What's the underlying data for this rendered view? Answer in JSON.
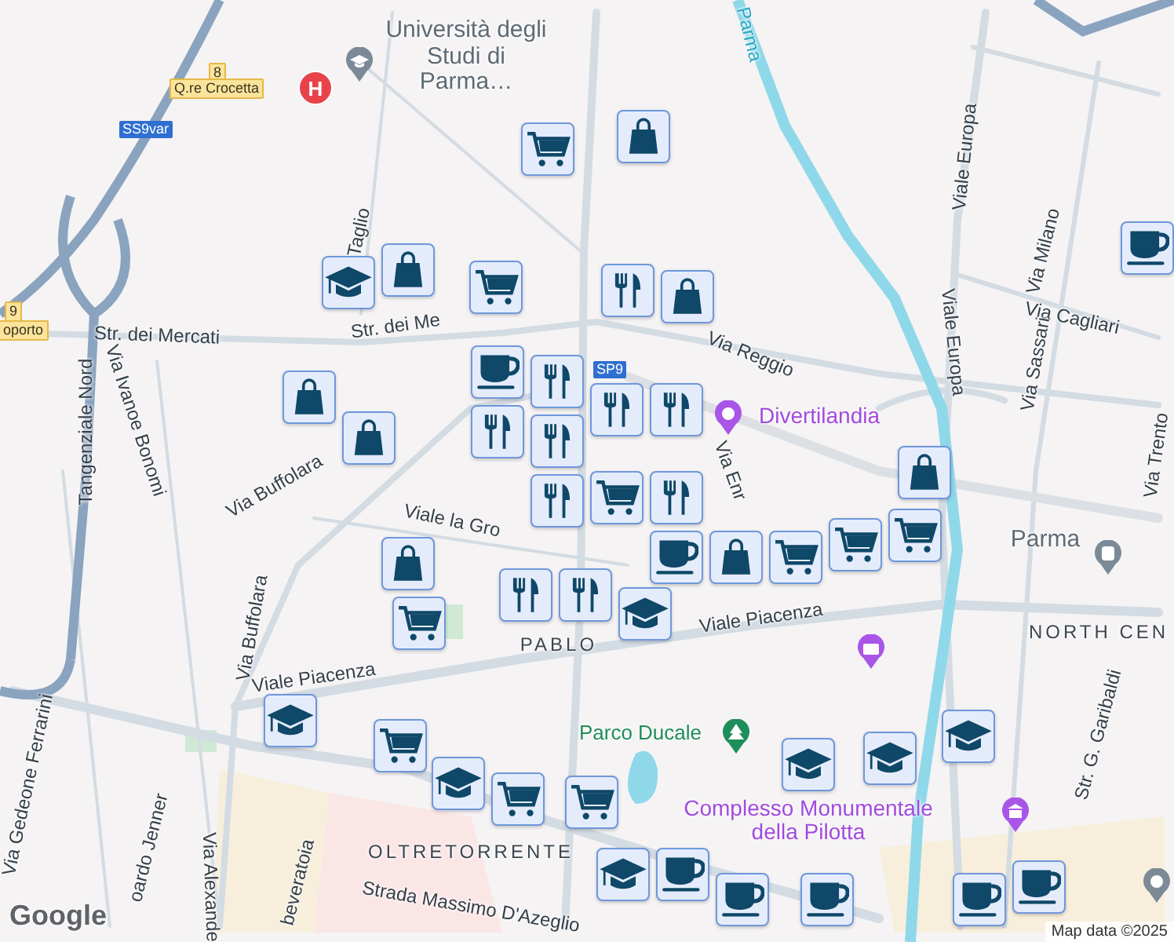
{
  "map": {
    "labels": [
      {
        "text": "Università degli Studi di Parma…",
        "kind": "poi"
      },
      {
        "text": "Taglio",
        "kind": "street"
      },
      {
        "text": "Str. dei Mercati",
        "kind": "street"
      },
      {
        "text": "Str. dei Me",
        "kind": "street"
      },
      {
        "text": "Tangenziale Nord",
        "kind": "street"
      },
      {
        "text": "Via Ivanoe Bonomi",
        "kind": "street"
      },
      {
        "text": "Via Reggio",
        "kind": "street"
      },
      {
        "text": "Divertilandia",
        "kind": "attraction"
      },
      {
        "text": "Parma",
        "kind": "water"
      },
      {
        "text": "Viale Europa",
        "kind": "street"
      },
      {
        "text": "Viale Europa",
        "kind": "street"
      },
      {
        "text": "Via Milano",
        "kind": "street"
      },
      {
        "text": "Via Cagliari",
        "kind": "street"
      },
      {
        "text": "Via Sassari",
        "kind": "street"
      },
      {
        "text": "Via Buffolara",
        "kind": "street"
      },
      {
        "text": "Via Buffolara",
        "kind": "street"
      },
      {
        "text": "Viale la Gro",
        "kind": "street"
      },
      {
        "text": "PABLO",
        "kind": "district"
      },
      {
        "text": "Viale Piacenza",
        "kind": "street"
      },
      {
        "text": "Viale Piacenza",
        "kind": "street"
      },
      {
        "text": "Parma",
        "kind": "poi"
      },
      {
        "text": "NORTH CEN",
        "kind": "district"
      },
      {
        "text": "Parco Ducale",
        "kind": "park"
      },
      {
        "text": "Complesso Monumentale della Pilotta",
        "kind": "attraction"
      },
      {
        "text": "Str. G. Garibaldi",
        "kind": "street"
      },
      {
        "text": "OLTRETORRENTE",
        "kind": "district"
      },
      {
        "text": "Strada Massimo D'Azeglio",
        "kind": "street"
      },
      {
        "text": "Via Alexande",
        "kind": "street"
      },
      {
        "text": "Via Gedeone Ferrarini",
        "kind": "street"
      },
      {
        "text": "oardo Jenner",
        "kind": "street"
      },
      {
        "text": "beveratoia",
        "kind": "street"
      },
      {
        "text": "Via Trento",
        "kind": "street"
      },
      {
        "text": "Via Enr",
        "kind": "street"
      }
    ],
    "shields": [
      {
        "text": "8",
        "kind": "yellow"
      },
      {
        "text": "Q.re Crocetta",
        "kind": "yellow"
      },
      {
        "text": "SS9var",
        "kind": "blue"
      },
      {
        "text": "9",
        "kind": "yellow"
      },
      {
        "text": "oporto",
        "kind": "yellow"
      },
      {
        "text": "SP9",
        "kind": "blue"
      }
    ],
    "poi_markers": [
      {
        "kind": "hospital",
        "text": "H"
      },
      {
        "kind": "university"
      },
      {
        "kind": "amusement"
      },
      {
        "kind": "camera"
      },
      {
        "kind": "park"
      },
      {
        "kind": "museum"
      },
      {
        "kind": "train"
      },
      {
        "kind": "church"
      }
    ],
    "pins": [
      {
        "kind": "cart"
      },
      {
        "kind": "bag"
      },
      {
        "kind": "cap"
      },
      {
        "kind": "bag"
      },
      {
        "kind": "cart"
      },
      {
        "kind": "fork"
      },
      {
        "kind": "bag"
      },
      {
        "kind": "cup"
      },
      {
        "kind": "fork"
      },
      {
        "kind": "fork"
      },
      {
        "kind": "fork"
      },
      {
        "kind": "bag"
      },
      {
        "kind": "bag"
      },
      {
        "kind": "fork"
      },
      {
        "kind": "fork"
      },
      {
        "kind": "fork"
      },
      {
        "kind": "cart"
      },
      {
        "kind": "fork"
      },
      {
        "kind": "cup"
      },
      {
        "kind": "bag"
      },
      {
        "kind": "cart"
      },
      {
        "kind": "cart"
      },
      {
        "kind": "cart"
      },
      {
        "kind": "bag"
      },
      {
        "kind": "bag"
      },
      {
        "kind": "cart"
      },
      {
        "kind": "fork"
      },
      {
        "kind": "fork"
      },
      {
        "kind": "cap"
      },
      {
        "kind": "cap"
      },
      {
        "kind": "cart"
      },
      {
        "kind": "cap"
      },
      {
        "kind": "cart"
      },
      {
        "kind": "cart"
      },
      {
        "kind": "cap"
      },
      {
        "kind": "cap"
      },
      {
        "kind": "cap"
      },
      {
        "kind": "cup"
      },
      {
        "kind": "cup"
      },
      {
        "kind": "cap"
      },
      {
        "kind": "cup"
      },
      {
        "kind": "cup"
      },
      {
        "kind": "cup"
      },
      {
        "kind": "cup"
      }
    ],
    "logo": "Google",
    "attribution": "Map data ©2025"
  }
}
